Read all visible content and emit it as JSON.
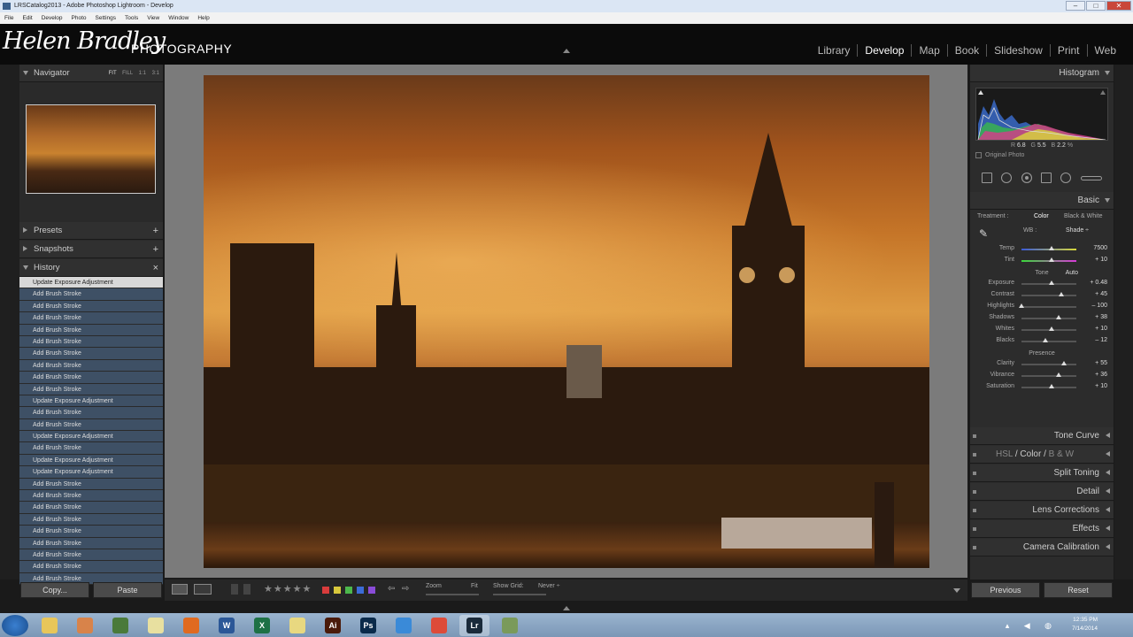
{
  "window": {
    "title": "LRSCatalog2013 - Adobe Photoshop Lightroom - Develop",
    "min": "–",
    "max": "□",
    "close": "✕"
  },
  "menu": [
    "File",
    "Edit",
    "Develop",
    "Photo",
    "Settings",
    "Tools",
    "View",
    "Window",
    "Help"
  ],
  "identity": {
    "name": "Helen Bradley",
    "tagline": "PHOTOGRAPHY"
  },
  "modules": [
    "Library",
    "Develop",
    "Map",
    "Book",
    "Slideshow",
    "Print",
    "Web"
  ],
  "active_module": "Develop",
  "left": {
    "navigator": {
      "label": "Navigator",
      "opt_fit": "FIT",
      "opt_fill": "FILL",
      "opt_11": "1:1",
      "opt_31": "3:1"
    },
    "presets": "Presets",
    "snapshots": "Snapshots",
    "history_label": "History",
    "history": [
      "Update Exposure Adjustment",
      "Add Brush Stroke",
      "Add Brush Stroke",
      "Add Brush Stroke",
      "Add Brush Stroke",
      "Add Brush Stroke",
      "Add Brush Stroke",
      "Add Brush Stroke",
      "Add Brush Stroke",
      "Add Brush Stroke",
      "Update Exposure Adjustment",
      "Add Brush Stroke",
      "Add Brush Stroke",
      "Update Exposure Adjustment",
      "Add Brush Stroke",
      "Update Exposure Adjustment",
      "Update Exposure Adjustment",
      "Add Brush Stroke",
      "Add Brush Stroke",
      "Add Brush Stroke",
      "Add Brush Stroke",
      "Add Brush Stroke",
      "Add Brush Stroke",
      "Add Brush Stroke",
      "Add Brush Stroke",
      "Add Brush Stroke"
    ],
    "copy_label": "Copy...",
    "paste_label": "Paste"
  },
  "toolbar": {
    "stars": "★★★★★",
    "zoom_label": "Zoom",
    "zoom_value": "Fit",
    "grid_label": "Show Grid:",
    "grid_value": "Never ÷",
    "colors": [
      "#d83c3c",
      "#d8c83c",
      "#4cb84c",
      "#3c6cd8",
      "#8a4cd8"
    ]
  },
  "right": {
    "histogram_label": "Histogram",
    "hist_values": {
      "r_label": "R",
      "r": "6.8",
      "g_label": "G",
      "g": "5.5",
      "b_label": "B",
      "b": "2.2",
      "unit": "%"
    },
    "original_photo": "Original Photo",
    "basic_label": "Basic",
    "treatment_label": "Treatment :",
    "treatment_color": "Color",
    "treatment_bw": "Black & White",
    "wb_label": "WB :",
    "wb_value": "Shade ÷",
    "tone_label": "Tone",
    "auto_label": "Auto",
    "presence_label": "Presence",
    "sliders": [
      {
        "label": "Temp",
        "value": "7500",
        "pos": 0.55
      },
      {
        "label": "Tint",
        "value": "+ 10",
        "pos": 0.55
      },
      {
        "label": "Exposure",
        "value": "+ 0.48",
        "pos": 0.55
      },
      {
        "label": "Contrast",
        "value": "+ 45",
        "pos": 0.72
      },
      {
        "label": "Highlights",
        "value": "– 100",
        "pos": 0.0
      },
      {
        "label": "Shadows",
        "value": "+ 38",
        "pos": 0.68
      },
      {
        "label": "Whites",
        "value": "+ 10",
        "pos": 0.55
      },
      {
        "label": "Blacks",
        "value": "– 12",
        "pos": 0.44
      },
      {
        "label": "Clarity",
        "value": "+ 55",
        "pos": 0.77
      },
      {
        "label": "Vibrance",
        "value": "+ 36",
        "pos": 0.68
      },
      {
        "label": "Saturation",
        "value": "+ 10",
        "pos": 0.55
      }
    ],
    "panels": {
      "tone_curve": "Tone Curve",
      "hsl": "HSL",
      "color": "Color",
      "bw": "B & W",
      "split": "Split Toning",
      "detail": "Detail",
      "lens": "Lens Corrections",
      "effects": "Effects",
      "camera": "Camera Calibration"
    },
    "previous_label": "Previous",
    "reset_label": "Reset"
  },
  "tray": {
    "time": "12:35 PM",
    "date": "7/14/2014"
  },
  "taskbar_apps": [
    {
      "name": "explorer",
      "color": "#e8c65a",
      "text": ""
    },
    {
      "name": "paint",
      "color": "#d8834a",
      "text": ""
    },
    {
      "name": "app3",
      "color": "#4a7a3a",
      "text": ""
    },
    {
      "name": "notepad",
      "color": "#e8e0a0",
      "text": ""
    },
    {
      "name": "firefox",
      "color": "#e06a20",
      "text": ""
    },
    {
      "name": "word",
      "color": "#2b5797",
      "text": "W"
    },
    {
      "name": "excel",
      "color": "#1e7145",
      "text": "X"
    },
    {
      "name": "app8",
      "color": "#e8d880",
      "text": ""
    },
    {
      "name": "illustrator",
      "color": "#4a1a0a",
      "text": "Ai"
    },
    {
      "name": "photoshop",
      "color": "#0a2a4a",
      "text": "Ps"
    },
    {
      "name": "app11",
      "color": "#3a8ad8",
      "text": ""
    },
    {
      "name": "chrome",
      "color": "#dd4b39",
      "text": ""
    },
    {
      "name": "lightroom",
      "color": "#1a2a3a",
      "text": "Lr"
    },
    {
      "name": "app14",
      "color": "#7a9a5a",
      "text": ""
    }
  ]
}
